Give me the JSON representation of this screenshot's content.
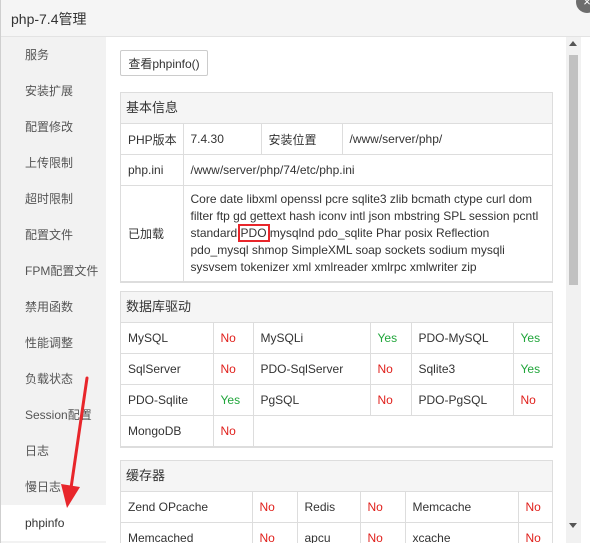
{
  "window": {
    "title": "php-7.4管理",
    "close_label": "×"
  },
  "sidebar": {
    "items": [
      {
        "label": "服务"
      },
      {
        "label": "安装扩展"
      },
      {
        "label": "配置修改"
      },
      {
        "label": "上传限制"
      },
      {
        "label": "超时限制"
      },
      {
        "label": "配置文件"
      },
      {
        "label": "FPM配置文件"
      },
      {
        "label": "禁用函数"
      },
      {
        "label": "性能调整"
      },
      {
        "label": "负载状态"
      },
      {
        "label": "Session配置"
      },
      {
        "label": "日志"
      },
      {
        "label": "慢日志"
      },
      {
        "label": "phpinfo"
      }
    ],
    "active_index": 13
  },
  "toolbar": {
    "view_phpinfo": "查看phpinfo()"
  },
  "basic": {
    "title": "基本信息",
    "version_label": "PHP版本",
    "version_value": "7.4.30",
    "install_label": "安装位置",
    "install_value": "/www/server/php/",
    "ini_label": "php.ini",
    "ini_value": "/www/server/php/74/etc/php.ini",
    "loaded_label": "已加载",
    "loaded_before": "Core date libxml openssl pcre sqlite3 zlib bcmath ctype curl dom filter ftp gd gettext hash iconv intl json mbstring SPL session pcntl standard ",
    "loaded_highlight": "PDO",
    "loaded_after": " mysqlnd pdo_sqlite Phar posix Reflection pdo_mysql shmop SimpleXML soap sockets sodium mysqli sysvsem tokenizer xml xmlreader xmlrpc xmlwriter zip"
  },
  "db": {
    "title": "数据库驱动",
    "rows": [
      [
        {
          "name": "MySQL",
          "status": "No"
        },
        {
          "name": "MySQLi",
          "status": "Yes"
        },
        {
          "name": "PDO-MySQL",
          "status": "Yes"
        }
      ],
      [
        {
          "name": "SqlServer",
          "status": "No"
        },
        {
          "name": "PDO-SqlServer",
          "status": "No"
        },
        {
          "name": "Sqlite3",
          "status": "Yes"
        }
      ],
      [
        {
          "name": "PDO-Sqlite",
          "status": "Yes"
        },
        {
          "name": "PgSQL",
          "status": "No"
        },
        {
          "name": "PDO-PgSQL",
          "status": "No"
        }
      ],
      [
        {
          "name": "MongoDB",
          "status": "No"
        }
      ]
    ]
  },
  "cache": {
    "title": "缓存器",
    "rows": [
      [
        {
          "name": "Zend OPcache",
          "status": "No"
        },
        {
          "name": "Redis",
          "status": "No"
        },
        {
          "name": "Memcache",
          "status": "No"
        }
      ],
      [
        {
          "name": "Memcached",
          "status": "No"
        },
        {
          "name": "apcu",
          "status": "No"
        },
        {
          "name": "xcache",
          "status": "No"
        }
      ]
    ]
  },
  "colors": {
    "no": "#e0201c",
    "yes": "#20a53a",
    "annotation": "#e8262b"
  }
}
